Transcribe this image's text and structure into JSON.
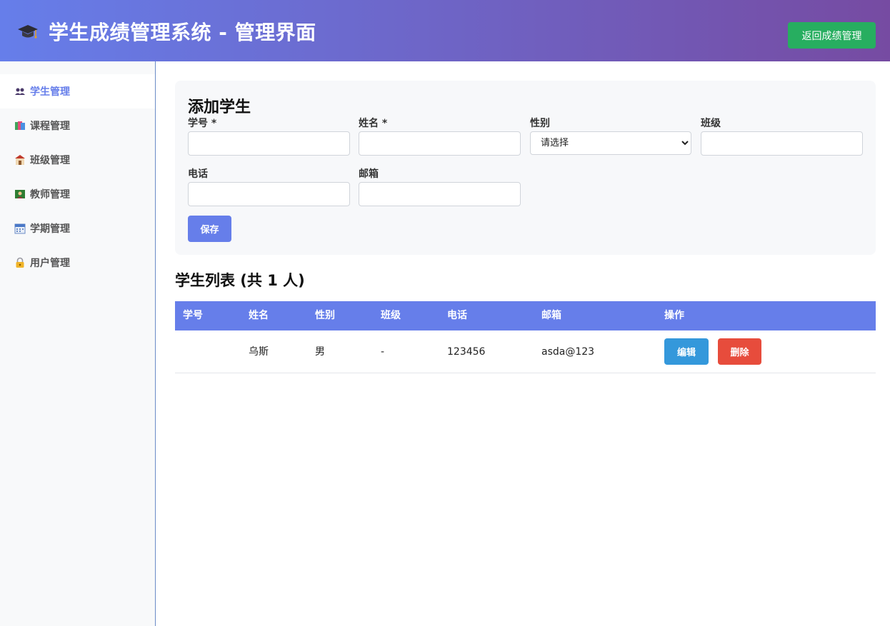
{
  "header": {
    "title": "学生成绩管理系统 - 管理界面",
    "back_button": "返回成绩管理",
    "icon": "graduation-cap-icon"
  },
  "sidebar": {
    "items": [
      {
        "label": "学生管理",
        "icon": "students-icon",
        "active": true
      },
      {
        "label": "课程管理",
        "icon": "books-icon",
        "active": false
      },
      {
        "label": "班级管理",
        "icon": "school-icon",
        "active": false
      },
      {
        "label": "教师管理",
        "icon": "teacher-icon",
        "active": false
      },
      {
        "label": "学期管理",
        "icon": "calendar-icon",
        "active": false
      },
      {
        "label": "用户管理",
        "icon": "lock-icon",
        "active": false
      }
    ]
  },
  "form": {
    "title": "添加学生",
    "fields": {
      "student_id": {
        "label": "学号 *",
        "value": ""
      },
      "name": {
        "label": "姓名 *",
        "value": ""
      },
      "gender": {
        "label": "性别",
        "selected": "请选择"
      },
      "class": {
        "label": "班级",
        "value": ""
      },
      "phone": {
        "label": "电话",
        "value": ""
      },
      "email": {
        "label": "邮箱",
        "value": ""
      }
    },
    "save_button": "保存"
  },
  "list": {
    "title": "学生列表 (共 1 人)",
    "columns": [
      "学号",
      "姓名",
      "性别",
      "班级",
      "电话",
      "邮箱",
      "操作"
    ],
    "rows": [
      {
        "id": "",
        "name": "乌斯",
        "gender": "男",
        "class": "-",
        "phone": "123456",
        "email": "asda@123",
        "edit": "编辑",
        "delete": "删除"
      }
    ]
  },
  "colors": {
    "header_gradient_start": "#667eea",
    "header_gradient_end": "#764ba2",
    "accent": "#667eea",
    "back_button": "#27ae60",
    "edit_button": "#3498db",
    "delete_button": "#e74c3c"
  }
}
